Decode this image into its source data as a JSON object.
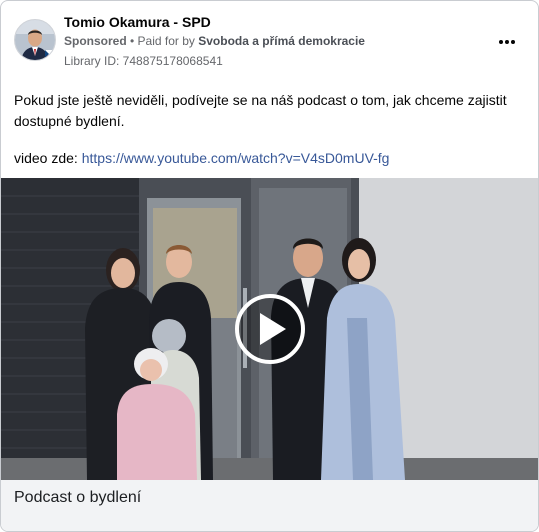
{
  "post": {
    "page_name": "Tomio Okamura - SPD",
    "sponsored_label": "Sponsored",
    "separator": " • ",
    "paid_for_prefix": "Paid for by ",
    "payer": "Svoboda a přímá demokracie",
    "library_id": "Library ID: 748875178068541",
    "more_icon": "more-horizontal-icon",
    "text": "Pokud jste ještě neviděli, podívejte se na náš podcast o tom, jak chceme zajistit dostupné bydlení.",
    "video_prefix": "video zde: ",
    "video_link": "https://www.youtube.com/watch?v=V4sD0mUV-fg"
  },
  "media": {
    "play_icon": "play-icon"
  },
  "caption": {
    "title": "Podcast o bydlení"
  },
  "colors": {
    "link": "#385898",
    "caption_bg": "#f2f3f5",
    "secondary_text": "#65676b"
  }
}
